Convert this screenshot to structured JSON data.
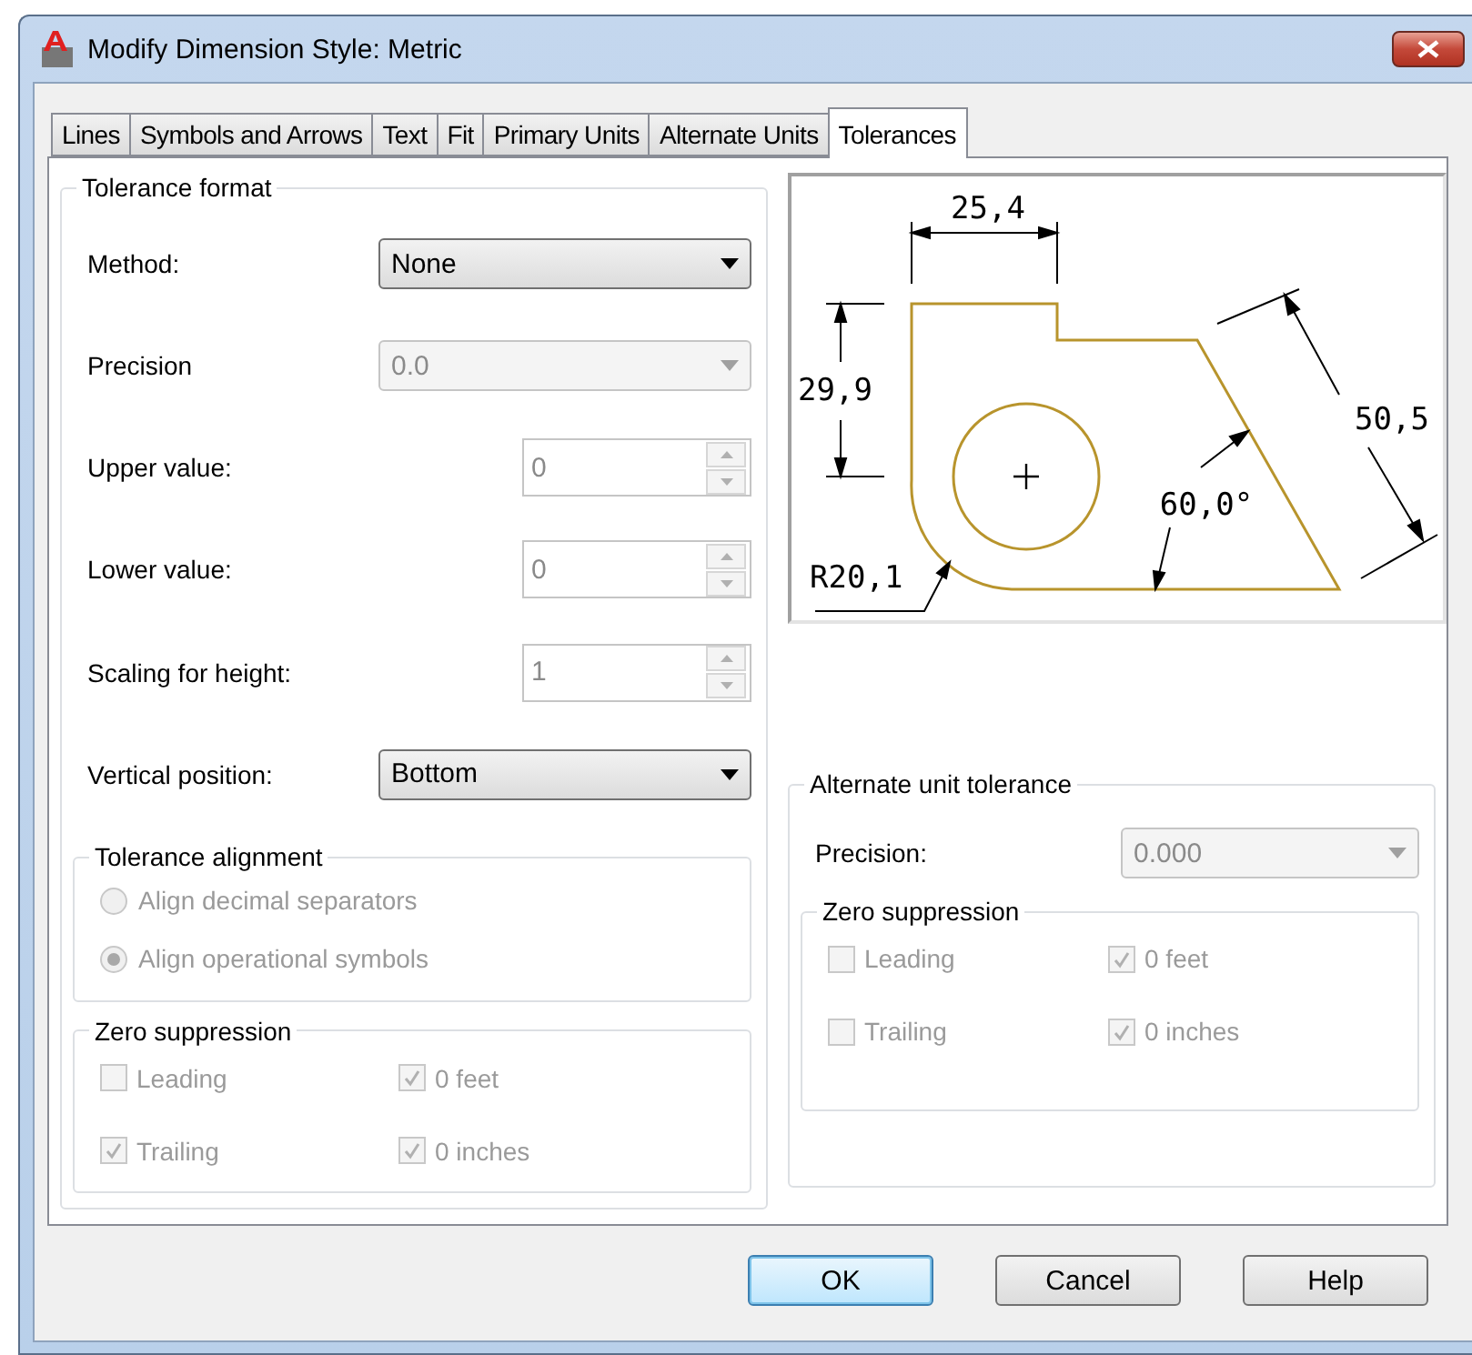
{
  "window": {
    "title": "Modify Dimension Style: Metric"
  },
  "tabs": [
    {
      "label": "Lines",
      "selected": false
    },
    {
      "label": "Symbols and Arrows",
      "selected": false
    },
    {
      "label": "Text",
      "selected": false
    },
    {
      "label": "Fit",
      "selected": false
    },
    {
      "label": "Primary Units",
      "selected": false
    },
    {
      "label": "Alternate Units",
      "selected": false
    },
    {
      "label": "Tolerances",
      "selected": true
    }
  ],
  "tolerance_format": {
    "title": "Tolerance format",
    "fields": [
      {
        "kind": "dropdown",
        "label": "Method:",
        "value": "None",
        "disabled": false
      },
      {
        "kind": "dropdown",
        "label": "Precision",
        "value": "0.0",
        "disabled": true
      },
      {
        "kind": "spinner",
        "label": "Upper value:",
        "value": "0",
        "disabled": true
      },
      {
        "kind": "spinner",
        "label": "Lower value:",
        "value": "0",
        "disabled": true
      },
      {
        "kind": "spinner",
        "label": "Scaling for height:",
        "value": "1",
        "disabled": true
      },
      {
        "kind": "dropdown",
        "label": "Vertical position:",
        "value": "Bottom",
        "disabled": false
      }
    ],
    "alignment": {
      "title": "Tolerance alignment",
      "options": [
        {
          "label": "Align decimal separators",
          "selected": false,
          "disabled": true
        },
        {
          "label": "Align operational symbols",
          "selected": true,
          "disabled": true
        }
      ]
    },
    "zero_suppression": {
      "title": "Zero suppression",
      "options": [
        {
          "label": "Leading",
          "checked": false,
          "disabled": true
        },
        {
          "label": "0 feet",
          "checked": true,
          "disabled": true
        },
        {
          "label": "Trailing",
          "checked": true,
          "disabled": true
        },
        {
          "label": "0 inches",
          "checked": true,
          "disabled": true
        }
      ]
    }
  },
  "preview": {
    "labels": [
      "25,4",
      "29,9",
      "50,5",
      "60,0°",
      "R20,1"
    ]
  },
  "alternate_unit_tolerance": {
    "title": "Alternate unit tolerance",
    "precision": {
      "label": "Precision:",
      "value": "0.000",
      "disabled": true
    },
    "zero_suppression": {
      "title": "Zero suppression",
      "options": [
        {
          "label": "Leading",
          "checked": false,
          "disabled": true
        },
        {
          "label": "0 feet",
          "checked": true,
          "disabled": true
        },
        {
          "label": "Trailing",
          "checked": false,
          "disabled": true
        },
        {
          "label": "0 inches",
          "checked": true,
          "disabled": true
        }
      ]
    }
  },
  "buttons": [
    {
      "label": "OK",
      "default": true
    },
    {
      "label": "Cancel",
      "default": false
    },
    {
      "label": "Help",
      "default": false
    }
  ]
}
